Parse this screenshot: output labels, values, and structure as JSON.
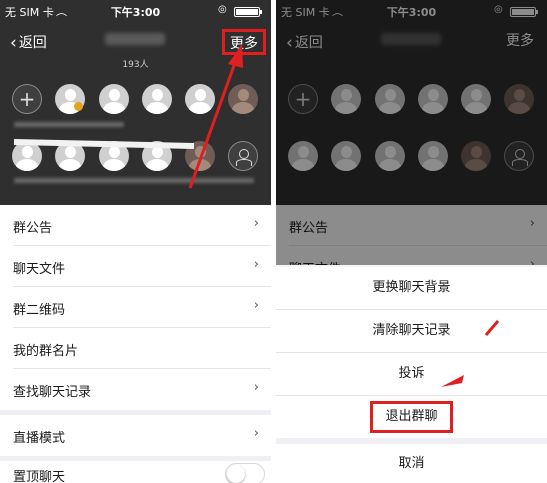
{
  "status_bar": {
    "carrier": "无 SIM 卡",
    "time": "下午3:00",
    "battery_level": 1.0
  },
  "nav": {
    "back_label": "返回",
    "more_label": "更多"
  },
  "member_count": "193人",
  "settings_list": [
    {
      "label": "群公告"
    },
    {
      "label": "聊天文件"
    },
    {
      "label": "群二维码"
    },
    {
      "label": "我的群名片"
    },
    {
      "label": "查找聊天记录"
    },
    {
      "label": "直播模式"
    },
    {
      "label": "置顶聊天"
    }
  ],
  "background_list": [
    {
      "label": "群公告"
    },
    {
      "label": "聊天文件"
    }
  ],
  "action_sheet": {
    "items": [
      "更换聊天背景",
      "清除聊天记录",
      "投诉",
      "退出群聊"
    ],
    "cancel": "取消"
  },
  "colors": {
    "highlight": "#e02020",
    "header_bg": "#2f2f2f"
  }
}
